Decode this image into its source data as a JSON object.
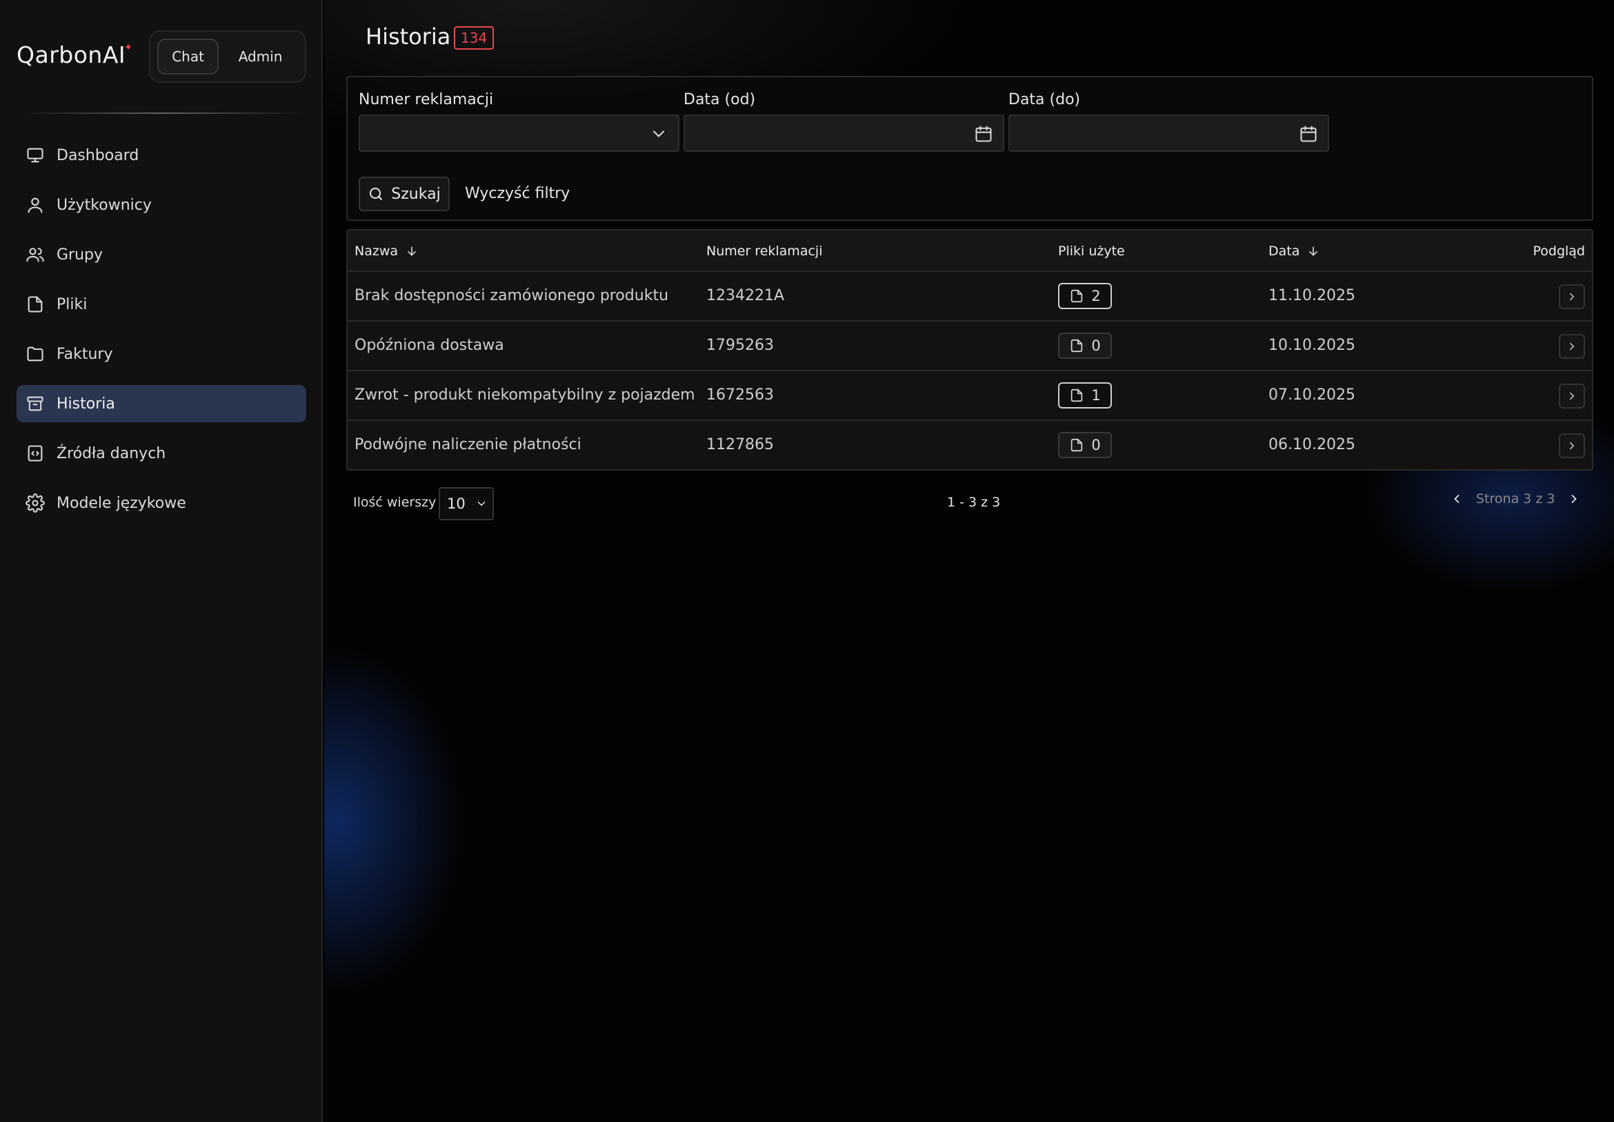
{
  "app": {
    "logo": "QarbonAI",
    "mode_switch": {
      "chat": "Chat",
      "admin": "Admin",
      "active": "chat"
    }
  },
  "sidebar": {
    "items": [
      {
        "label": "Dashboard",
        "icon": "monitor-icon"
      },
      {
        "label": "Użytkownicy",
        "icon": "user-icon"
      },
      {
        "label": "Grupy",
        "icon": "users-icon"
      },
      {
        "label": "Pliki",
        "icon": "file-icon"
      },
      {
        "label": "Faktury",
        "icon": "folder-icon"
      },
      {
        "label": "Historia",
        "icon": "archive-icon",
        "active": true
      },
      {
        "label": "Źródła danych",
        "icon": "code-file-icon"
      },
      {
        "label": "Modele językowe",
        "icon": "gear-icon"
      }
    ]
  },
  "page": {
    "title": "Historia",
    "count": "134"
  },
  "filters": {
    "complaint_number_label": "Numer reklamacji",
    "date_from_label": "Data (od)",
    "date_to_label": "Data (do)",
    "complaint_number_value": "",
    "date_from_value": "",
    "date_to_value": "",
    "search_label": "Szukaj",
    "clear_label": "Wyczyść filtry"
  },
  "table": {
    "columns": {
      "name": "Nazwa",
      "complaint_number": "Numer reklamacji",
      "files_used": "Pliki użyte",
      "date": "Data",
      "preview": "Podgląd"
    },
    "rows": [
      {
        "name": "Brak dostępności zamówionego produktu",
        "complaint_number": "1234221A",
        "files": "2",
        "date": "11.10.2025"
      },
      {
        "name": "Opóźniona dostawa",
        "complaint_number": "1795263",
        "files": "0",
        "date": "10.10.2025"
      },
      {
        "name": "Zwrot - produkt niekompatybilny z pojazdem",
        "complaint_number": "1672563",
        "files": "1",
        "date": "07.10.2025"
      },
      {
        "name": "Podwójne naliczenie płatności",
        "complaint_number": "1127865",
        "files": "0",
        "date": "06.10.2025"
      }
    ]
  },
  "pagination": {
    "rows_label": "Ilość wierszy",
    "rows_value": "10",
    "range": "1 - 3 z 3",
    "page_text": "Strona 3 z 3"
  },
  "colors": {
    "accent_red": "#e5484d",
    "active_nav_bg": "#2a3550",
    "glow_blue": "#1946aa"
  }
}
